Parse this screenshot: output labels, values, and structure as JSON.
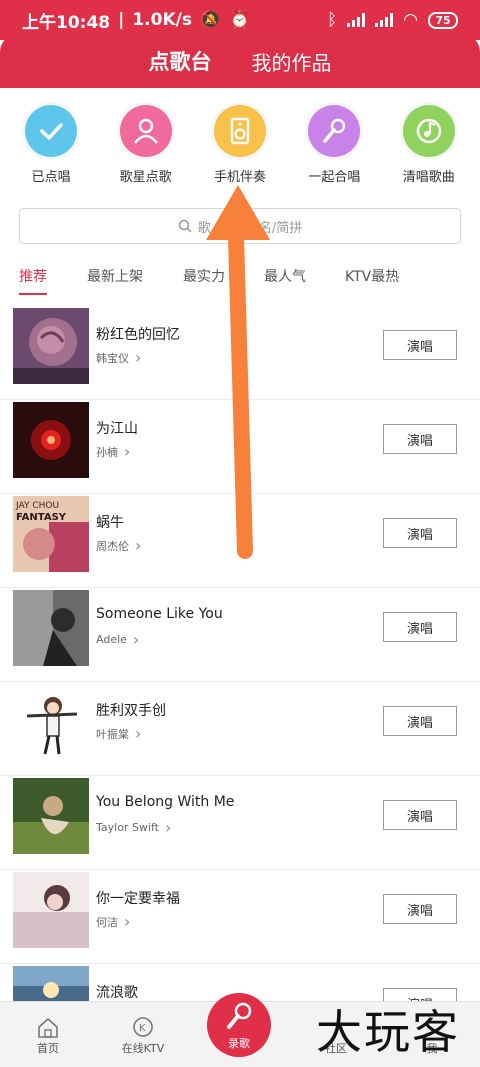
{
  "status": {
    "time": "上午10:48",
    "speed": "1.0K/s",
    "battery": "75"
  },
  "header": {
    "tabs": [
      {
        "label": "点歌台"
      },
      {
        "label": "我的作品"
      }
    ]
  },
  "quick": [
    {
      "label": "已点唱",
      "color": "#5ec6ea",
      "icon": "check-icon"
    },
    {
      "label": "歌星点歌",
      "color": "#f06a9c",
      "icon": "singer-icon"
    },
    {
      "label": "手机伴奏",
      "color": "#f7c14a",
      "icon": "speaker-icon"
    },
    {
      "label": "一起合唱",
      "color": "#c882e8",
      "icon": "mic-icon"
    },
    {
      "label": "清唱歌曲",
      "color": "#8fd35e",
      "icon": "music-note-icon"
    }
  ],
  "search": {
    "placeholder": "歌曲名/简拼",
    "visible_text": "歌",
    "visible_text_tail": "名/简拼"
  },
  "categories": [
    "推荐",
    "最新上架",
    "最实力",
    "最人气",
    "KTV最热"
  ],
  "songs": [
    {
      "title": "粉红色的回忆",
      "artist": "韩宝仪"
    },
    {
      "title": "为江山",
      "artist": "孙楠"
    },
    {
      "title": "蜗牛",
      "artist": "周杰伦",
      "cover_text_1": "JAY CHOU",
      "cover_text_2": "FANTASY"
    },
    {
      "title": "Someone Like You",
      "artist": "Adele"
    },
    {
      "title": "胜利双手创",
      "artist": "叶振棠"
    },
    {
      "title": "You Belong With Me",
      "artist": "Taylor Swift"
    },
    {
      "title": "你一定要幸福",
      "artist": "何洁"
    },
    {
      "title": "流浪歌",
      "artist": ""
    }
  ],
  "sing_label": "演唱",
  "bottom_nav": {
    "home": "首页",
    "ktv": "在线KTV",
    "record": "录歌",
    "community": "社区",
    "me": "我"
  },
  "watermark": "大玩客",
  "colors": {
    "brand": "#e03049",
    "arrow": "#f7813a"
  }
}
